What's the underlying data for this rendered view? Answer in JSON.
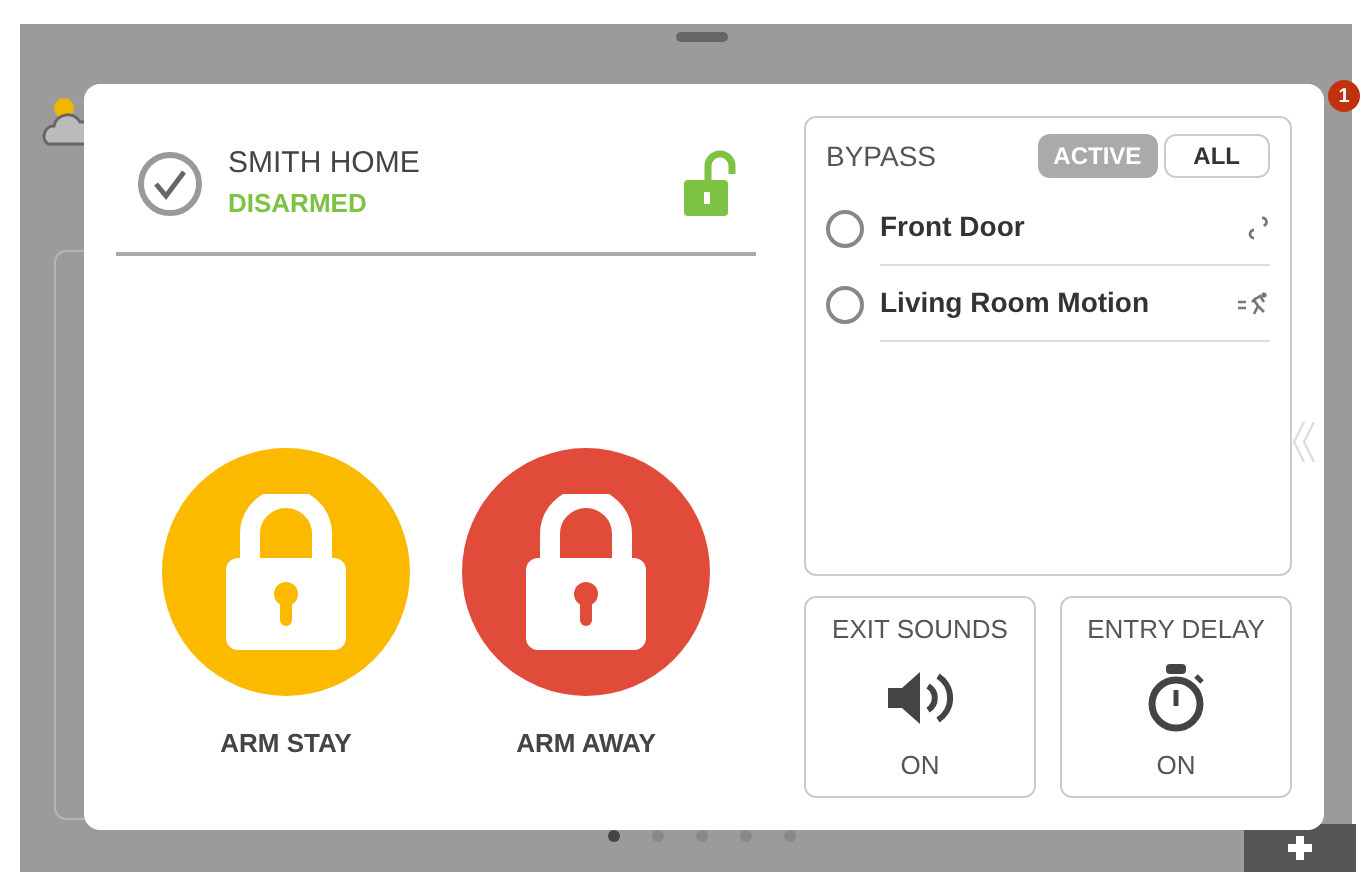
{
  "background": {
    "notification_badge": "1",
    "page_dots": [
      {
        "selected": true
      },
      {
        "selected": false
      },
      {
        "selected": false
      },
      {
        "selected": false
      },
      {
        "selected": false
      }
    ]
  },
  "status": {
    "name": "SMITH HOME",
    "state": "DISARMED",
    "locked": false
  },
  "arm_buttons": [
    {
      "label": "ARM STAY",
      "color": "#fbb900"
    },
    {
      "label": "ARM AWAY",
      "color": "#e04b3a"
    }
  ],
  "bypass": {
    "title": "BYPASS",
    "filters": [
      {
        "label": "ACTIVE",
        "selected": true
      },
      {
        "label": "ALL",
        "selected": false
      }
    ],
    "zones": [
      {
        "name": "Front Door",
        "checked": false,
        "kind": "door"
      },
      {
        "name": "Living Room Motion",
        "checked": false,
        "kind": "motion"
      }
    ]
  },
  "toggles": [
    {
      "label": "EXIT SOUNDS",
      "value": "ON",
      "kind": "sound"
    },
    {
      "label": "ENTRY DELAY",
      "value": "ON",
      "kind": "timer"
    }
  ]
}
